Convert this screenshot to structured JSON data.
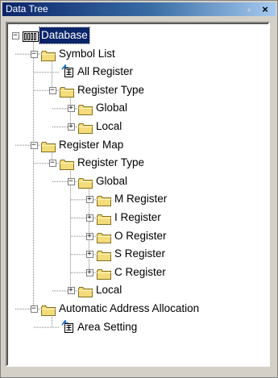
{
  "window": {
    "title": "Data Tree",
    "pin_glyph": "▲",
    "close_glyph": "×"
  },
  "tree": {
    "expanded_glyph": "−",
    "collapsed_glyph": "+",
    "nodes": [
      {
        "id": "database",
        "label": "Database",
        "icon": "database-icon",
        "toggle": "expanded",
        "selected": true
      },
      {
        "id": "symbol-list",
        "label": "Symbol List",
        "icon": "folder-icon",
        "toggle": "expanded"
      },
      {
        "id": "all-register",
        "label": "All Register",
        "icon": "table-document-icon",
        "toggle": "none"
      },
      {
        "id": "register-type-1",
        "label": "Register Type",
        "icon": "folder-icon",
        "toggle": "expanded"
      },
      {
        "id": "global-1",
        "label": "Global",
        "icon": "folder-icon",
        "toggle": "collapsed"
      },
      {
        "id": "local-1",
        "label": "Local",
        "icon": "folder-icon",
        "toggle": "collapsed"
      },
      {
        "id": "register-map",
        "label": "Register Map",
        "icon": "folder-icon",
        "toggle": "expanded"
      },
      {
        "id": "register-type-2",
        "label": "Register Type",
        "icon": "folder-icon",
        "toggle": "expanded"
      },
      {
        "id": "global-2",
        "label": "Global",
        "icon": "folder-icon",
        "toggle": "expanded"
      },
      {
        "id": "m-register",
        "label": "M Register",
        "icon": "folder-icon",
        "toggle": "collapsed"
      },
      {
        "id": "i-register",
        "label": "I Register",
        "icon": "folder-icon",
        "toggle": "collapsed"
      },
      {
        "id": "o-register",
        "label": "O Register",
        "icon": "folder-icon",
        "toggle": "collapsed"
      },
      {
        "id": "s-register",
        "label": "S Register",
        "icon": "folder-icon",
        "toggle": "collapsed"
      },
      {
        "id": "c-register",
        "label": "C Register",
        "icon": "folder-icon",
        "toggle": "collapsed"
      },
      {
        "id": "local-2",
        "label": "Local",
        "icon": "folder-icon",
        "toggle": "collapsed"
      },
      {
        "id": "automatic-address-allocation",
        "label": "Automatic Address Allocation",
        "icon": "folder-icon",
        "toggle": "expanded"
      },
      {
        "id": "area-setting",
        "label": "Area Setting",
        "icon": "table-document-icon",
        "toggle": "none"
      }
    ]
  }
}
